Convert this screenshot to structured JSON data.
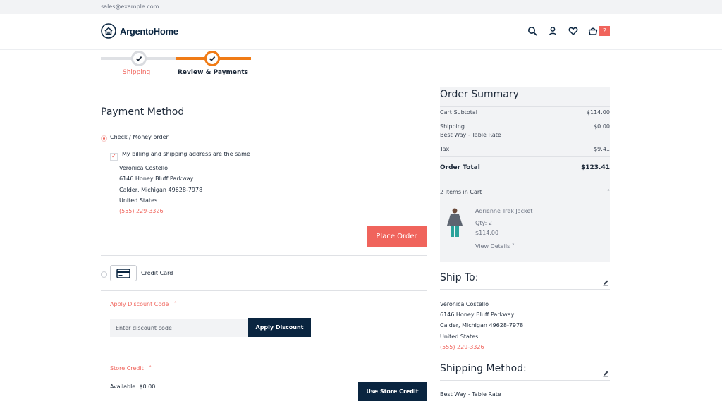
{
  "topbar": {
    "email": "sales@example.com"
  },
  "header": {
    "logo_text": "ArgentoHome",
    "icons": [
      "search-icon",
      "account-icon",
      "wishlist-heart-icon",
      "cart-icon"
    ],
    "cart_count": "2",
    "accent": "#f0645c"
  },
  "progress": {
    "steps": [
      {
        "label": "Shipping",
        "state": "complete"
      },
      {
        "label": "Review & Payments",
        "state": "active"
      }
    ],
    "colors": {
      "active": "#f07b16",
      "complete": "#d9dbdf"
    }
  },
  "payment": {
    "title": "Payment Method",
    "check_money_label": "Check / Money order",
    "same_address_label": "My billing and shipping address are the same",
    "address": {
      "name": "Veronica Costello",
      "street": "6146 Honey Bluff Parkway",
      "city": "Calder, Michigan 49628-7978",
      "country": "United States",
      "phone": "(555) 229-3326"
    },
    "place_order_label": "Place Order",
    "credit_card_label": "Credit Card"
  },
  "discount": {
    "toggle_label": "Apply Discount Code",
    "placeholder": "Enter discount code",
    "button_label": "Apply Discount"
  },
  "store_credit": {
    "toggle_label": "Store Credit",
    "available": "Available: $0.00",
    "button_label": "Use Store Credit"
  },
  "summary": {
    "title": "Order Summary",
    "rows": [
      {
        "label": "Cart Subtotal",
        "value": "$114.00"
      },
      {
        "label": "Shipping",
        "value": "$0.00",
        "sub": "Best Way - Table Rate"
      },
      {
        "label": "Tax",
        "value": "$9.41"
      }
    ],
    "total_label": "Order Total",
    "total_value": "$123.41",
    "items_header": "2 Items in Cart",
    "item": {
      "name": "Adrienne Trek Jacket",
      "qty": "Qty: 2",
      "price": "$114.00",
      "details_label": "View Details"
    }
  },
  "ship_to": {
    "title": "Ship To:",
    "name": "Veronica Costello",
    "street": "6146 Honey Bluff Parkway",
    "city": "Calder, Michigan 49628-7978",
    "country": "United States",
    "phone": "(555) 229-3326"
  },
  "shipping_method": {
    "title": "Shipping Method:",
    "value": "Best Way - Table Rate"
  }
}
